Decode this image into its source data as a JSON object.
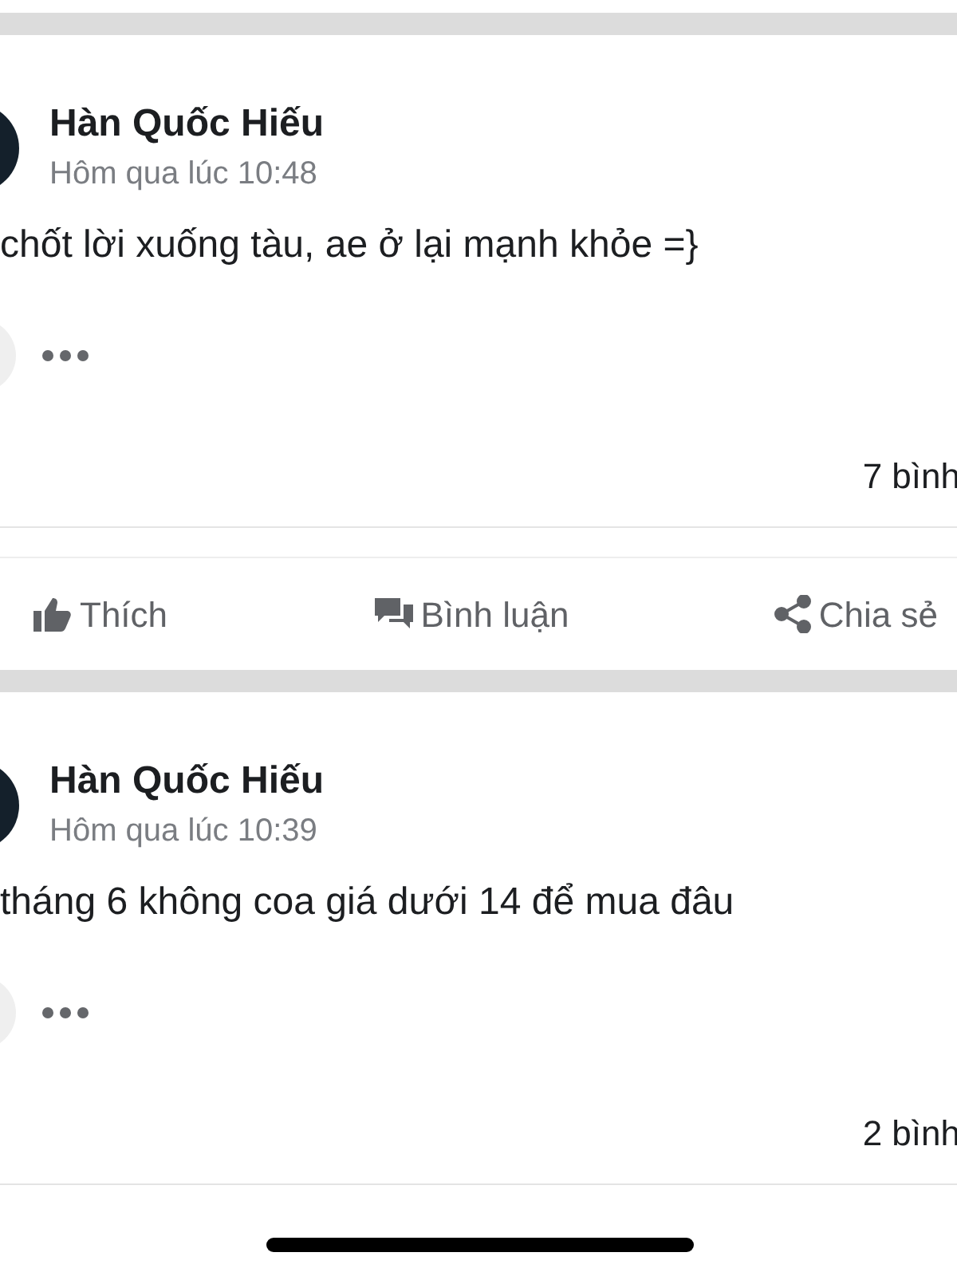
{
  "posts": [
    {
      "author": "Hàn Quốc Hiếu",
      "time": "Hôm qua lúc 10:48",
      "text": "chốt lời xuống tàu, ae ở lại mạnh khỏe =}",
      "comments": "7 bình",
      "actions": [
        {
          "kind": "like",
          "label": "Thích"
        },
        {
          "kind": "comment",
          "label": "Bình luận"
        },
        {
          "kind": "share",
          "label": "Chia sẻ"
        }
      ]
    },
    {
      "author": "Hàn Quốc Hiếu",
      "time": "Hôm qua lúc 10:39",
      "text": "tháng 6 không coa giá dưới 14 để mua đâu",
      "comments": "2 bình"
    }
  ]
}
